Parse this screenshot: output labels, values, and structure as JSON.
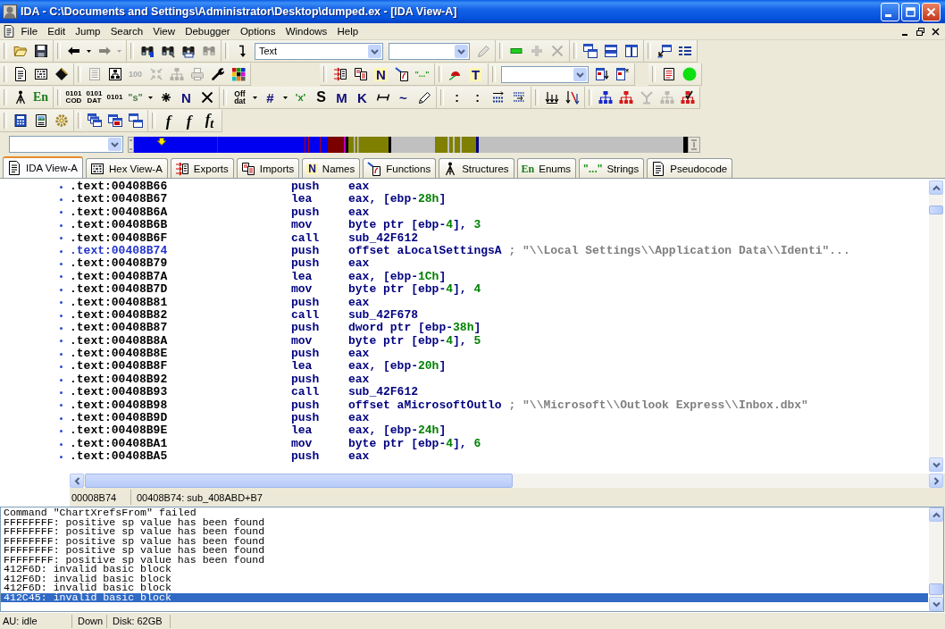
{
  "window": {
    "title": "IDA - C:\\Documents and Settings\\Administrator\\Desktop\\dumped.ex - [IDA View-A]"
  },
  "menu": [
    "File",
    "Edit",
    "Jump",
    "Search",
    "View",
    "Debugger",
    "Options",
    "Windows",
    "Help"
  ],
  "toolbar_rows": [
    [
      {
        "buttons": [
          {
            "kind": "icon",
            "disabled": false
          },
          {
            "kind": "icon",
            "disabled": false
          }
        ]
      },
      {
        "buttons": [
          {
            "kind": "icon",
            "disabled": false
          },
          {
            "kind": "caret",
            "disabled": false
          },
          {
            "kind": "icon",
            "disabled": true
          },
          {
            "kind": "caret",
            "disabled": true
          }
        ]
      },
      {
        "buttons": [
          {
            "kind": "icon",
            "disabled": false
          },
          {
            "kind": "icon",
            "disabled": false
          },
          {
            "kind": "icon",
            "disabled": false
          },
          {
            "kind": "icon",
            "disabled": true
          }
        ]
      },
      {
        "buttons": [
          {
            "kind": "icon",
            "disabled": false
          },
          {
            "kind": "combo",
            "value": "Text"
          },
          {
            "kind": "combo"
          },
          {
            "kind": "icon",
            "disabled": true
          }
        ]
      },
      {
        "buttons": [
          {
            "kind": "icon",
            "disabled": false
          },
          {
            "kind": "icon",
            "disabled": true
          },
          {
            "kind": "icon",
            "disabled": true
          }
        ]
      },
      {
        "buttons": [
          {
            "kind": "icon",
            "disabled": false
          },
          {
            "kind": "icon",
            "disabled": false
          },
          {
            "kind": "icon",
            "disabled": false
          }
        ]
      },
      {
        "buttons": [
          {
            "kind": "icon",
            "disabled": false
          },
          {
            "kind": "icon",
            "disabled": false
          }
        ]
      }
    ],
    [
      {
        "buttons": [
          {
            "kind": "icon",
            "disabled": false
          },
          {
            "kind": "icon",
            "disabled": false
          },
          {
            "kind": "icon",
            "disabled": false
          }
        ]
      },
      {
        "buttons": [
          {
            "kind": "icon",
            "disabled": true
          },
          {
            "kind": "icon",
            "disabled": false
          },
          {
            "kind": "glyph",
            "glyph": "100",
            "disabled": true
          },
          {
            "kind": "icon",
            "disabled": true
          },
          {
            "kind": "icon",
            "disabled": true
          },
          {
            "kind": "icon",
            "disabled": true
          },
          {
            "kind": "icon",
            "disabled": false
          },
          {
            "kind": "icon",
            "disabled": false
          }
        ]
      },
      {
        "buttons": [
          {
            "kind": "icon",
            "disabled": false
          },
          {
            "kind": "icon",
            "disabled": false
          },
          {
            "kind": "glyph",
            "glyph": "N",
            "disabled": false
          },
          {
            "kind": "icon",
            "disabled": false
          },
          {
            "kind": "glyph",
            "glyph": "\"...\"",
            "disabled": false
          }
        ]
      },
      {
        "buttons": [
          {
            "kind": "icon",
            "disabled": false
          },
          {
            "kind": "glyph",
            "glyph": "T",
            "disabled": false
          }
        ]
      },
      {
        "buttons": [
          {
            "kind": "combo"
          },
          {
            "kind": "icon",
            "disabled": false
          },
          {
            "kind": "icon",
            "disabled": false
          }
        ]
      },
      {
        "buttons": [
          {
            "kind": "icon",
            "disabled": false
          },
          {
            "kind": "icon",
            "disabled": false
          }
        ]
      }
    ],
    [
      {
        "buttons": [
          {
            "kind": "icon",
            "disabled": false
          },
          {
            "kind": "glyph",
            "glyph": "En",
            "disabled": false
          }
        ]
      },
      {
        "buttons": [
          {
            "kind": "glyph",
            "glyph": "0101 COD",
            "disabled": false
          },
          {
            "kind": "glyph",
            "glyph": "0101 DAT",
            "disabled": false
          },
          {
            "kind": "glyph",
            "glyph": "0101",
            "disabled": false
          },
          {
            "kind": "glyph",
            "glyph": "\"s\"",
            "disabled": false
          },
          {
            "kind": "caret",
            "disabled": false
          },
          {
            "kind": "icon",
            "disabled": false
          },
          {
            "kind": "glyph",
            "glyph": "N",
            "disabled": false
          },
          {
            "kind": "icon",
            "disabled": false
          }
        ]
      },
      {
        "buttons": [
          {
            "kind": "glyph",
            "glyph": "Off dat",
            "disabled": false
          },
          {
            "kind": "caret",
            "disabled": false
          },
          {
            "kind": "glyph",
            "glyph": "#",
            "disabled": false
          },
          {
            "kind": "caret",
            "disabled": false
          },
          {
            "kind": "glyph",
            "glyph": "'x'",
            "disabled": false
          },
          {
            "kind": "glyph",
            "glyph": "S",
            "disabled": false
          },
          {
            "kind": "glyph",
            "glyph": "M",
            "disabled": false
          },
          {
            "kind": "glyph",
            "glyph": "K",
            "disabled": false
          },
          {
            "kind": "icon",
            "disabled": false
          },
          {
            "kind": "glyph",
            "glyph": "~",
            "disabled": false
          },
          {
            "kind": "icon",
            "disabled": false
          }
        ]
      },
      {
        "buttons": [
          {
            "kind": "glyph",
            "glyph": ":",
            "disabled": false
          },
          {
            "kind": "glyph",
            "glyph": ":",
            "disabled": false
          },
          {
            "kind": "icon",
            "disabled": false
          },
          {
            "kind": "icon",
            "disabled": false
          }
        ]
      },
      {
        "buttons": [
          {
            "kind": "icon",
            "disabled": false
          },
          {
            "kind": "icon",
            "disabled": false
          }
        ]
      },
      {
        "buttons": [
          {
            "kind": "icon",
            "disabled": false
          },
          {
            "kind": "icon",
            "disabled": false
          },
          {
            "kind": "icon",
            "disabled": true
          },
          {
            "kind": "icon",
            "disabled": true
          },
          {
            "kind": "icon",
            "disabled": false
          }
        ]
      }
    ],
    [
      {
        "buttons": [
          {
            "kind": "icon",
            "disabled": false
          },
          {
            "kind": "icon",
            "disabled": false
          },
          {
            "kind": "icon",
            "disabled": false
          }
        ]
      },
      {
        "buttons": [
          {
            "kind": "icon",
            "disabled": false
          },
          {
            "kind": "icon",
            "disabled": false
          },
          {
            "kind": "icon",
            "disabled": false
          }
        ]
      },
      {
        "buttons": [
          {
            "kind": "glyph",
            "glyph": "f",
            "disabled": false
          },
          {
            "kind": "glyph",
            "glyph": "f",
            "disabled": false
          },
          {
            "kind": "glyph",
            "glyph": "f$_{t}$",
            "disabled": false
          }
        ]
      }
    ]
  ],
  "tabs": [
    {
      "label": "IDA View-A",
      "selected": true
    },
    {
      "label": "Hex View-A",
      "selected": false
    },
    {
      "label": "Exports",
      "selected": false
    },
    {
      "label": "Imports",
      "selected": false
    },
    {
      "label": "Names",
      "glyph": "N",
      "selected": false
    },
    {
      "label": "Functions",
      "selected": false
    },
    {
      "label": "Structures",
      "selected": false
    },
    {
      "label": "Enums",
      "glyph": "En",
      "selected": false
    },
    {
      "label": "Strings",
      "glyph": "\"...\"",
      "selected": false
    },
    {
      "label": "Pseudocode",
      "selected": false
    }
  ],
  "listing": {
    "lines": [
      {
        "address": ".text:00408B66",
        "mnemonic": "push",
        "operands": [
          {
            "text": "eax",
            "kind": "plain"
          }
        ],
        "selected": false
      },
      {
        "address": ".text:00408B67",
        "mnemonic": "lea",
        "operands": [
          {
            "text": "eax, [ebp-",
            "kind": "plain"
          },
          {
            "text": "28h",
            "kind": "number"
          },
          {
            "text": "]",
            "kind": "plain"
          }
        ],
        "selected": false
      },
      {
        "address": ".text:00408B6A",
        "mnemonic": "push",
        "operands": [
          {
            "text": "eax",
            "kind": "plain"
          }
        ],
        "selected": false
      },
      {
        "address": ".text:00408B6B",
        "mnemonic": "mov",
        "operands": [
          {
            "text": "byte ptr [ebp-",
            "kind": "plain"
          },
          {
            "text": "4",
            "kind": "number"
          },
          {
            "text": "], ",
            "kind": "plain"
          },
          {
            "text": "3",
            "kind": "number"
          }
        ],
        "selected": false
      },
      {
        "address": ".text:00408B6F",
        "mnemonic": "call",
        "operands": [
          {
            "text": "sub_42F612",
            "kind": "plain"
          }
        ],
        "selected": false
      },
      {
        "address": ".text:00408B74",
        "mnemonic": "push",
        "operands": [
          {
            "text": "offset aLocalSettingsA",
            "kind": "plain"
          }
        ],
        "comment": "; \"\\\\Local Settings\\\\Application Data\\\\Identi\"...",
        "selected": true
      },
      {
        "address": ".text:00408B79",
        "mnemonic": "push",
        "operands": [
          {
            "text": "eax",
            "kind": "plain"
          }
        ],
        "selected": false
      },
      {
        "address": ".text:00408B7A",
        "mnemonic": "lea",
        "operands": [
          {
            "text": "eax, [ebp-",
            "kind": "plain"
          },
          {
            "text": "1Ch",
            "kind": "number"
          },
          {
            "text": "]",
            "kind": "plain"
          }
        ],
        "selected": false
      },
      {
        "address": ".text:00408B7D",
        "mnemonic": "mov",
        "operands": [
          {
            "text": "byte ptr [ebp-",
            "kind": "plain"
          },
          {
            "text": "4",
            "kind": "number"
          },
          {
            "text": "], ",
            "kind": "plain"
          },
          {
            "text": "4",
            "kind": "number"
          }
        ],
        "selected": false
      },
      {
        "address": ".text:00408B81",
        "mnemonic": "push",
        "operands": [
          {
            "text": "eax",
            "kind": "plain"
          }
        ],
        "selected": false
      },
      {
        "address": ".text:00408B82",
        "mnemonic": "call",
        "operands": [
          {
            "text": "sub_42F678",
            "kind": "plain"
          }
        ],
        "selected": false
      },
      {
        "address": ".text:00408B87",
        "mnemonic": "push",
        "operands": [
          {
            "text": "dword ptr [ebp-",
            "kind": "plain"
          },
          {
            "text": "38h",
            "kind": "number"
          },
          {
            "text": "]",
            "kind": "plain"
          }
        ],
        "selected": false
      },
      {
        "address": ".text:00408B8A",
        "mnemonic": "mov",
        "operands": [
          {
            "text": "byte ptr [ebp-",
            "kind": "plain"
          },
          {
            "text": "4",
            "kind": "number"
          },
          {
            "text": "], ",
            "kind": "plain"
          },
          {
            "text": "5",
            "kind": "number"
          }
        ],
        "selected": false
      },
      {
        "address": ".text:00408B8E",
        "mnemonic": "push",
        "operands": [
          {
            "text": "eax",
            "kind": "plain"
          }
        ],
        "selected": false
      },
      {
        "address": ".text:00408B8F",
        "mnemonic": "lea",
        "operands": [
          {
            "text": "eax, [ebp-",
            "kind": "plain"
          },
          {
            "text": "20h",
            "kind": "number"
          },
          {
            "text": "]",
            "kind": "plain"
          }
        ],
        "selected": false
      },
      {
        "address": ".text:00408B92",
        "mnemonic": "push",
        "operands": [
          {
            "text": "eax",
            "kind": "plain"
          }
        ],
        "selected": false
      },
      {
        "address": ".text:00408B93",
        "mnemonic": "call",
        "operands": [
          {
            "text": "sub_42F612",
            "kind": "plain"
          }
        ],
        "selected": false
      },
      {
        "address": ".text:00408B98",
        "mnemonic": "push",
        "operands": [
          {
            "text": "offset aMicrosoftOutlo",
            "kind": "plain"
          }
        ],
        "comment": "; \"\\\\Microsoft\\\\Outlook Express\\\\Inbox.dbx\"",
        "selected": false
      },
      {
        "address": ".text:00408B9D",
        "mnemonic": "push",
        "operands": [
          {
            "text": "eax",
            "kind": "plain"
          }
        ],
        "selected": false
      },
      {
        "address": ".text:00408B9E",
        "mnemonic": "lea",
        "operands": [
          {
            "text": "eax, [ebp-",
            "kind": "plain"
          },
          {
            "text": "24h",
            "kind": "number"
          },
          {
            "text": "]",
            "kind": "plain"
          }
        ],
        "selected": false
      },
      {
        "address": ".text:00408BA1",
        "mnemonic": "mov",
        "operands": [
          {
            "text": "byte ptr [ebp-",
            "kind": "plain"
          },
          {
            "text": "4",
            "kind": "number"
          },
          {
            "text": "], ",
            "kind": "plain"
          },
          {
            "text": "6",
            "kind": "number"
          }
        ],
        "selected": false
      },
      {
        "address": ".text:00408BA5",
        "mnemonic": "push",
        "operands": [
          {
            "text": "eax",
            "kind": "plain"
          }
        ],
        "selected": false
      }
    ]
  },
  "position_bar": {
    "offset": "00008B74",
    "location": "00408B74: sub_408ABD+B7"
  },
  "output": {
    "lines": [
      {
        "text": "Command \"ChartXrefsFrom\" failed",
        "selected": false
      },
      {
        "text": "FFFFFFFF: positive sp value has been found",
        "selected": false
      },
      {
        "text": "FFFFFFFF: positive sp value has been found",
        "selected": false
      },
      {
        "text": "FFFFFFFF: positive sp value has been found",
        "selected": false
      },
      {
        "text": "FFFFFFFF: positive sp value has been found",
        "selected": false
      },
      {
        "text": "FFFFFFFF: positive sp value has been found",
        "selected": false
      },
      {
        "text": "412F6D: invalid basic block",
        "selected": false
      },
      {
        "text": "412F6D: invalid basic block",
        "selected": false
      },
      {
        "text": "412F6D: invalid basic block",
        "selected": false
      },
      {
        "text": "412C45: invalid basic block",
        "selected": true
      }
    ]
  },
  "status_bar": [
    "AU: idle",
    "Down",
    "Disk: 62GB"
  ]
}
